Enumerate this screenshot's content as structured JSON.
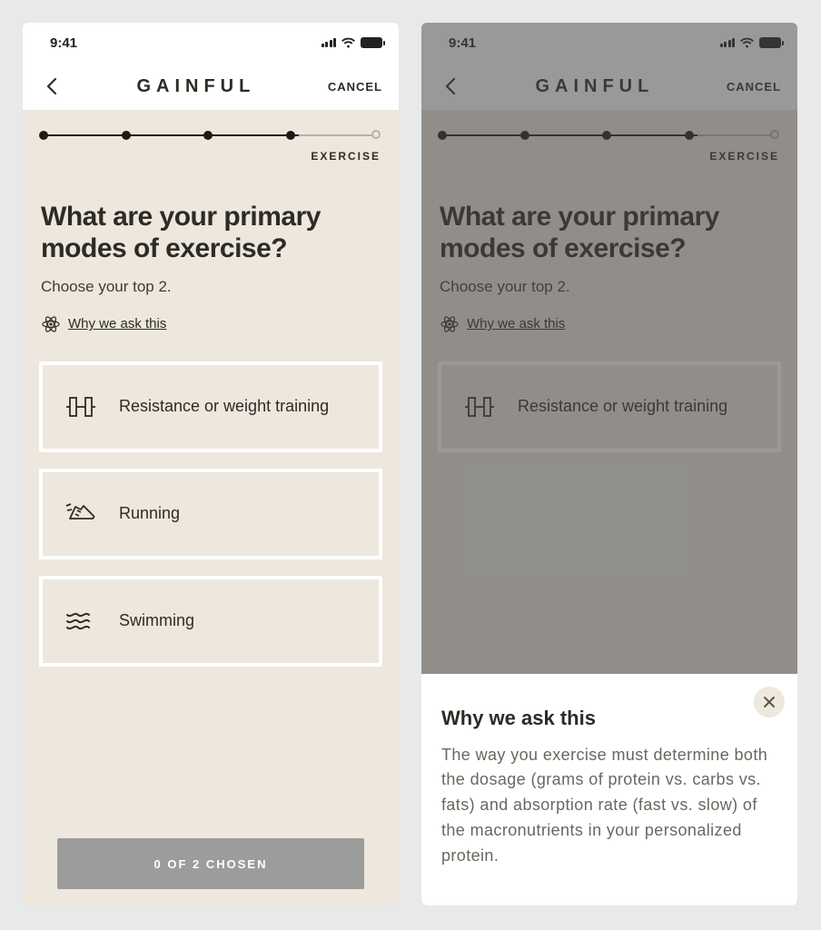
{
  "status": {
    "time": "9:41"
  },
  "nav": {
    "logo": "GAINFUL",
    "cancel": "CANCEL"
  },
  "progress": {
    "step_label": "EXERCISE",
    "total_steps": 5,
    "filled_steps": 4
  },
  "question": {
    "title": "What are your primary modes of exercise?",
    "subtitle": "Choose your top 2.",
    "why_link": "Why we ask this"
  },
  "options": [
    {
      "icon": "barbell-icon",
      "label": "Resistance or weight training"
    },
    {
      "icon": "running-shoe-icon",
      "label": "Running"
    },
    {
      "icon": "waves-icon",
      "label": "Swimming"
    }
  ],
  "footer": {
    "cta": "0 OF 2 CHOSEN"
  },
  "sheet": {
    "title": "Why we ask this",
    "body": "The way you exercise must determine both the dosage (grams of protein vs. carbs vs. fats) and absorption rate (fast vs. slow) of the macronutrients in your personalized protein."
  }
}
